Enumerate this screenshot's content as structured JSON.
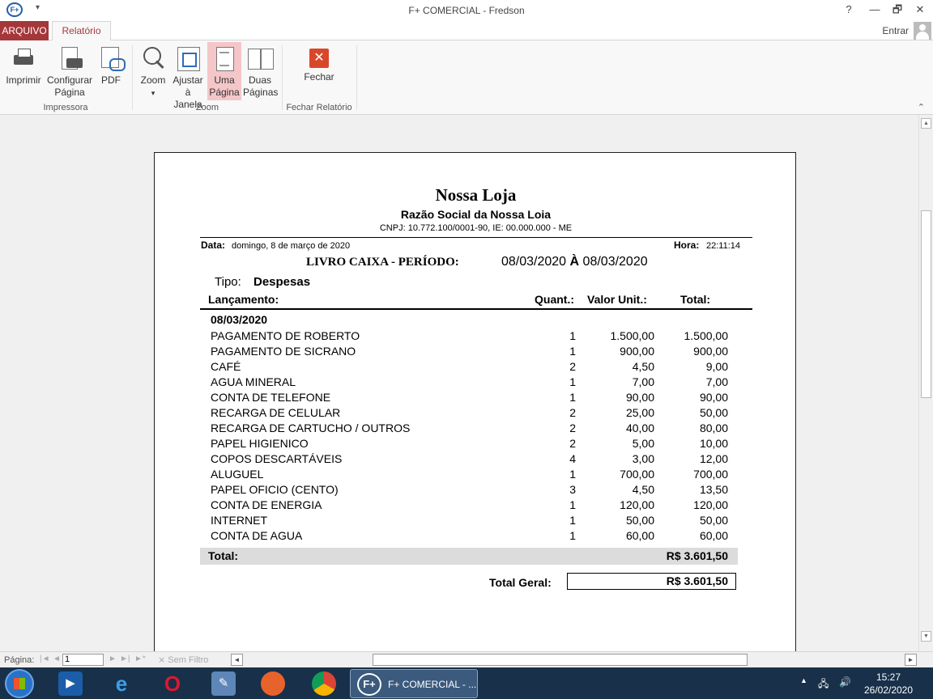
{
  "window": {
    "title": "F+ COMERCIAL - Fredson",
    "app_icon": "F+",
    "help": "?",
    "minimize": "—",
    "restore": "🗗",
    "close": "✕"
  },
  "tabs": {
    "file": "ARQUIVO",
    "report": "Relatório",
    "signin": "Entrar"
  },
  "ribbon": {
    "print": "Imprimir",
    "config_l1": "Configurar",
    "config_l2": "Página",
    "pdf": "PDF",
    "zoom": "Zoom",
    "zoom_arrow": "▾",
    "fit_l1": "Ajustar",
    "fit_l2": "à Janela",
    "one_l1": "Uma",
    "one_l2": "Página",
    "two_l1": "Duas",
    "two_l2": "Páginas",
    "close": "Fechar",
    "close_glyph": "✕",
    "group_printer": "Impressora",
    "group_zoom": "Zoom",
    "group_close": "Fechar Relatório",
    "collapse": "⌃"
  },
  "report": {
    "store": "Nossa Loja",
    "corporate": "Razão Social da Nossa Loia",
    "cnpj": "CNPJ: 10.772.100/0001-90,  IE: 00.000.000 - ME",
    "data_label": "Data:",
    "data_value": "domingo, 8 de março de 2020",
    "hora_label": "Hora:",
    "hora_value": "22:11:14",
    "title": "LIVRO CAIXA - PERÍODO:",
    "period_start": "08/03/2020",
    "period_sep": "À",
    "period_end": "08/03/2020",
    "tipo_label": "Tipo:",
    "tipo_value": "Despesas",
    "columns": {
      "desc": "Lançamento:",
      "qty": "Quant.:",
      "unit": "Valor Unit.:",
      "total": "Total:"
    },
    "group_date": "08/03/2020",
    "rows": [
      {
        "desc": "PAGAMENTO DE ROBERTO",
        "qty": "1",
        "unit": "1.500,00",
        "total": "1.500,00"
      },
      {
        "desc": "PAGAMENTO DE SICRANO",
        "qty": "1",
        "unit": "900,00",
        "total": "900,00"
      },
      {
        "desc": "CAFÉ",
        "qty": "2",
        "unit": "4,50",
        "total": "9,00"
      },
      {
        "desc": "AGUA MINERAL",
        "qty": "1",
        "unit": "7,00",
        "total": "7,00"
      },
      {
        "desc": "CONTA DE TELEFONE",
        "qty": "1",
        "unit": "90,00",
        "total": "90,00"
      },
      {
        "desc": "RECARGA DE CELULAR",
        "qty": "2",
        "unit": "25,00",
        "total": "50,00"
      },
      {
        "desc": "RECARGA DE CARTUCHO / OUTROS",
        "qty": "2",
        "unit": "40,00",
        "total": "80,00"
      },
      {
        "desc": "PAPEL HIGIENICO",
        "qty": "2",
        "unit": "5,00",
        "total": "10,00"
      },
      {
        "desc": "COPOS DESCARTÁVEIS",
        "qty": "4",
        "unit": "3,00",
        "total": "12,00"
      },
      {
        "desc": "ALUGUEL",
        "qty": "1",
        "unit": "700,00",
        "total": "700,00"
      },
      {
        "desc": "PAPEL OFICIO (CENTO)",
        "qty": "3",
        "unit": "4,50",
        "total": "13,50"
      },
      {
        "desc": "CONTA DE ENERGIA",
        "qty": "1",
        "unit": "120,00",
        "total": "120,00"
      },
      {
        "desc": "INTERNET",
        "qty": "1",
        "unit": "50,00",
        "total": "50,00"
      },
      {
        "desc": "CONTA DE AGUA",
        "qty": "1",
        "unit": "60,00",
        "total": "60,00"
      }
    ],
    "total_label": "Total:",
    "total_value": "R$ 3.601,50",
    "grand_label": "Total Geral:",
    "grand_value": "R$ 3.601,50"
  },
  "nav": {
    "page_label": "Página:",
    "page_value": "1",
    "first": "|◄",
    "prev": "◄",
    "next": "►",
    "last": "►|",
    "new": "►*",
    "filter": "Sem Filtro",
    "hs_left": "◄",
    "hs_right": "►"
  },
  "taskbar": {
    "active_label": "F+ COMERCIAL - ...",
    "active_icon": "F+",
    "tray_up": "▲",
    "time": "15:27",
    "date": "26/02/2020"
  }
}
